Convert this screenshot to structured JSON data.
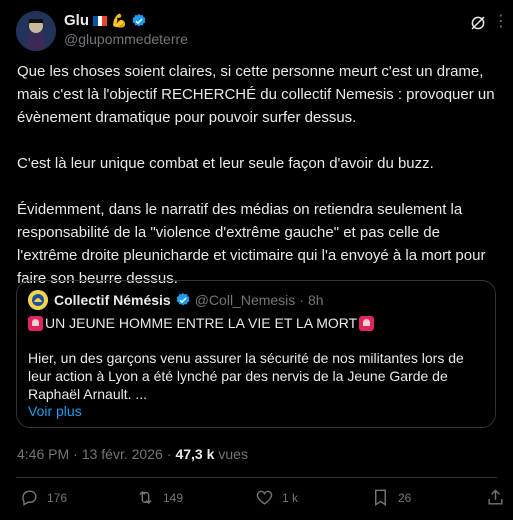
{
  "author": {
    "display_name": "Glu",
    "emoji": "💪",
    "handle": "@glupommedeterre",
    "verified_icon": "verified-badge-icon"
  },
  "body": {
    "paragraphs": [
      "Que les choses soient claires, si cette personne meurt c'est un drame, mais c'est là l'objectif RECHERCHÉ du collectif Nemesis : provoquer un évènement dramatique pour pouvoir surfer dessus.",
      "C'est là leur unique combat et leur seule façon d'avoir du buzz.",
      "Évidemment, dans le narratif des médias on retiendra seulement la responsabilité de la \"violence d'extrême gauche\" et pas celle de l'extrême droite pleunicharde et victimaire qui l'a envoyé à la mort pour faire son beurre dessus."
    ]
  },
  "quote": {
    "display_name": "Collectif Némésis",
    "handle": "@Coll_Nemesis",
    "separator": "·",
    "time": "8h",
    "title": "UN JEUNE HOMME ENTRE LA VIE ET LA MORT",
    "text": "Hier, un des garçons venu assurer la sécurité de nos militantes lors de leur action à Lyon a été lynché par des nervis de la Jeune Garde de Raphaël Arnault. ...",
    "more_label": "Voir plus"
  },
  "meta": {
    "time": "4:46 PM",
    "separator": "·",
    "date": "13 févr. 2026",
    "separator2": "·",
    "views_count": "47,3 k",
    "views_label": "vues"
  },
  "actions": {
    "replies": "176",
    "reposts": "149",
    "likes": "1 k",
    "bookmarks": "26"
  },
  "colors": {
    "background": "#000000",
    "text": "#e7e9ea",
    "muted": "#71767b",
    "accent": "#1d9bf0",
    "border": "#2f3336"
  }
}
